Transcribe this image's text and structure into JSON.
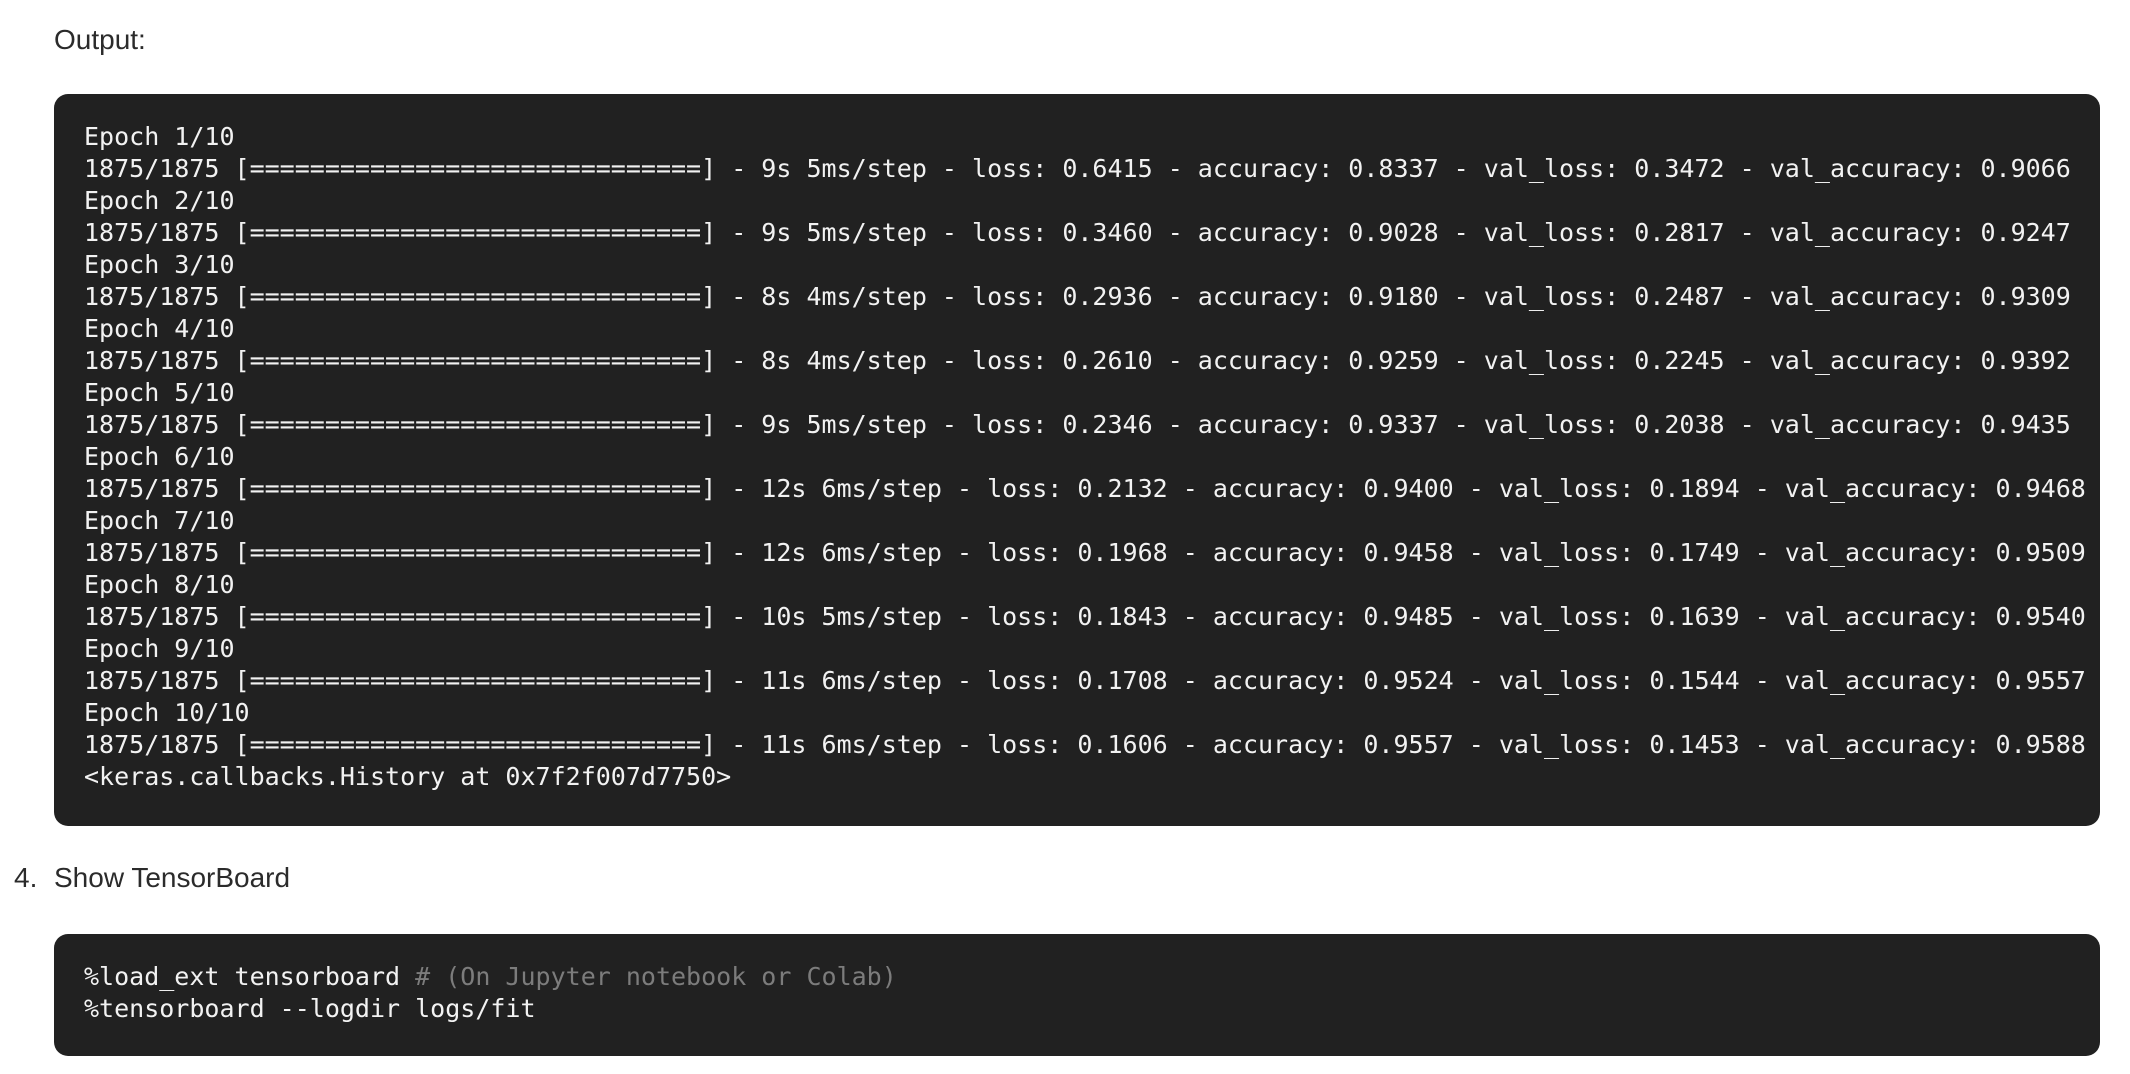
{
  "output_label": "Output:",
  "output_lines": [
    "Epoch 1/10",
    "1875/1875 [==============================] - 9s 5ms/step - loss: 0.6415 - accuracy: 0.8337 - val_loss: 0.3472 - val_accuracy: 0.9066",
    "Epoch 2/10",
    "1875/1875 [==============================] - 9s 5ms/step - loss: 0.3460 - accuracy: 0.9028 - val_loss: 0.2817 - val_accuracy: 0.9247",
    "Epoch 3/10",
    "1875/1875 [==============================] - 8s 4ms/step - loss: 0.2936 - accuracy: 0.9180 - val_loss: 0.2487 - val_accuracy: 0.9309",
    "Epoch 4/10",
    "1875/1875 [==============================] - 8s 4ms/step - loss: 0.2610 - accuracy: 0.9259 - val_loss: 0.2245 - val_accuracy: 0.9392",
    "Epoch 5/10",
    "1875/1875 [==============================] - 9s 5ms/step - loss: 0.2346 - accuracy: 0.9337 - val_loss: 0.2038 - val_accuracy: 0.9435",
    "Epoch 6/10",
    "1875/1875 [==============================] - 12s 6ms/step - loss: 0.2132 - accuracy: 0.9400 - val_loss: 0.1894 - val_accuracy: 0.9468",
    "Epoch 7/10",
    "1875/1875 [==============================] - 12s 6ms/step - loss: 0.1968 - accuracy: 0.9458 - val_loss: 0.1749 - val_accuracy: 0.9509",
    "Epoch 8/10",
    "1875/1875 [==============================] - 10s 5ms/step - loss: 0.1843 - accuracy: 0.9485 - val_loss: 0.1639 - val_accuracy: 0.9540",
    "Epoch 9/10",
    "1875/1875 [==============================] - 11s 6ms/step - loss: 0.1708 - accuracy: 0.9524 - val_loss: 0.1544 - val_accuracy: 0.9557",
    "Epoch 10/10",
    "1875/1875 [==============================] - 11s 6ms/step - loss: 0.1606 - accuracy: 0.9557 - val_loss: 0.1453 - val_accuracy: 0.9588",
    "<keras.callbacks.History at 0x7f2f007d7750>"
  ],
  "step": {
    "number": "4.",
    "label": "Show TensorBoard"
  },
  "command_lines": [
    {
      "code": "%load_ext tensorboard",
      "comment": " # (On Jupyter notebook or Colab)"
    },
    {
      "code": "%tensorboard --logdir logs/fit",
      "comment": ""
    }
  ],
  "colors": {
    "code_background": "#212121",
    "code_text": "#f2f2f2",
    "comment_text": "#7c7c7c",
    "body_text": "#2b2b2b"
  }
}
